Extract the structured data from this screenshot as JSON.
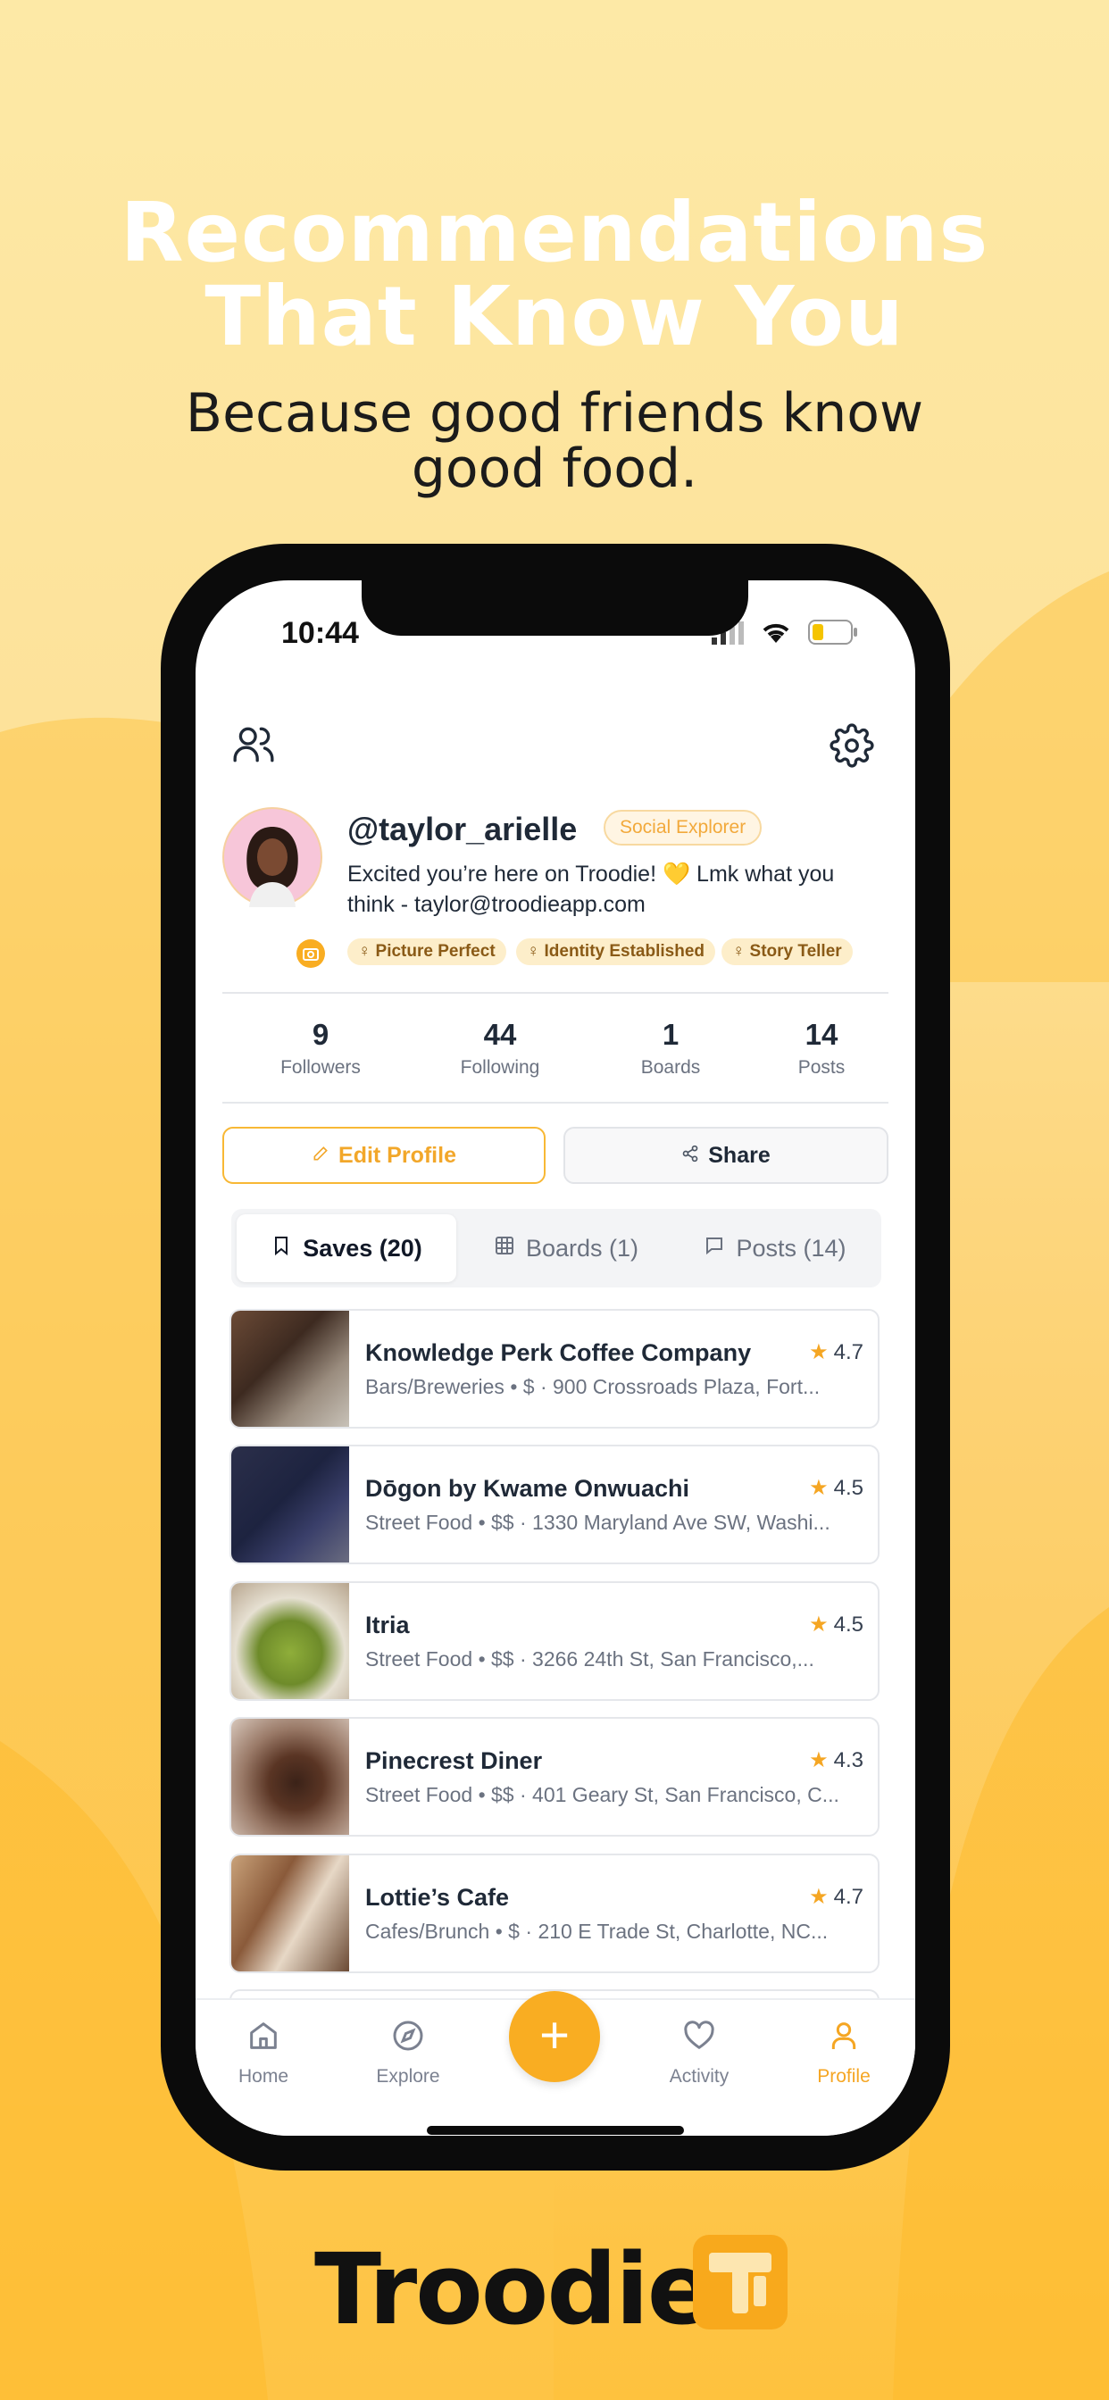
{
  "promo": {
    "headline_line1": "Recommendations",
    "headline_line2": "That Know You",
    "subline_line1": "Because good friends know",
    "subline_line2": "good food."
  },
  "status_bar": {
    "time": "10:44"
  },
  "profile": {
    "username": "@taylor_arielle",
    "level_badge": "Social Explorer",
    "bio_line1": "Excited you’re here on Troodie! 💛 Lmk what you",
    "bio_line2": "think - taylor@troodieapp.com",
    "achievements": [
      "Picture Perfect",
      "Identity Established",
      "Story Teller"
    ]
  },
  "stats": [
    {
      "value": "9",
      "label": "Followers"
    },
    {
      "value": "44",
      "label": "Following"
    },
    {
      "value": "1",
      "label": "Boards"
    },
    {
      "value": "14",
      "label": "Posts"
    }
  ],
  "actions": {
    "edit_label": "Edit Profile",
    "share_label": "Share"
  },
  "tabs": [
    {
      "label": "Saves (20)",
      "icon": "bookmark-icon",
      "active": true
    },
    {
      "label": "Boards (1)",
      "icon": "grid-icon",
      "active": false
    },
    {
      "label": "Posts (14)",
      "icon": "chat-icon",
      "active": false
    }
  ],
  "saves": [
    {
      "name": "Knowledge Perk Coffee Company",
      "rating": "4.7",
      "category": "Bars/Breweries • $",
      "address": "900 Crossroads Plaza, Fort..."
    },
    {
      "name": "Dōgon by Kwame Onwuachi",
      "rating": "4.5",
      "category": "Street Food • $$",
      "address": "1330 Maryland Ave SW, Washi..."
    },
    {
      "name": "Itria",
      "rating": "4.5",
      "category": "Street Food • $$",
      "address": "3266 24th St, San Francisco,..."
    },
    {
      "name": "Pinecrest Diner",
      "rating": "4.3",
      "category": "Street Food • $$",
      "address": "401 Geary St, San Francisco, C..."
    },
    {
      "name": "Lottie’s Cafe",
      "rating": "4.7",
      "category": "Cafes/Brunch • $",
      "address": "210 E Trade St, Charlotte, NC..."
    }
  ],
  "bottom_nav": [
    {
      "label": "Home",
      "icon": "home-icon",
      "active": false
    },
    {
      "label": "Explore",
      "icon": "compass-icon",
      "active": false
    },
    {
      "label": "Activity",
      "icon": "heart-icon",
      "active": false
    },
    {
      "label": "Profile",
      "icon": "person-icon",
      "active": true
    }
  ],
  "fab_symbol": "+",
  "brand": {
    "name": "Troodie"
  },
  "colors": {
    "accent": "#F9AD22",
    "background": "#FDE29A"
  }
}
